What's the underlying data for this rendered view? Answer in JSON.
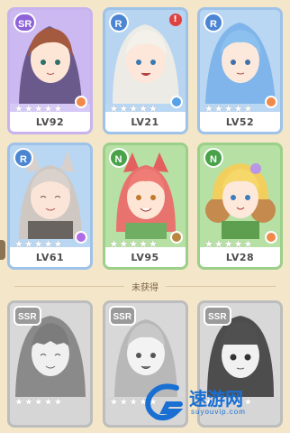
{
  "collected_label_unacquired": "未获得",
  "watermark": {
    "text": "速游网",
    "sub": "suyouvip.com"
  },
  "colors": {
    "rarity_sr": "#8e63d8",
    "rarity_r": "#4c86d3",
    "rarity_n": "#49a24a",
    "rarity_ssr": "#9a9a9a",
    "alert": "#e04040"
  },
  "cards": [
    {
      "rarity": "SR",
      "level": "LV92",
      "stars_lit": 0,
      "badge_color": "#f08a4b",
      "alert": false,
      "theme": "sr"
    },
    {
      "rarity": "R",
      "level": "LV21",
      "stars_lit": 0,
      "badge_color": "#58a0e8",
      "alert": true,
      "theme": "r"
    },
    {
      "rarity": "R",
      "level": "LV52",
      "stars_lit": 0,
      "badge_color": "#f08a4b",
      "alert": false,
      "theme": "r"
    },
    {
      "rarity": "R",
      "level": "LV61",
      "stars_lit": 0,
      "badge_color": "#b06be6",
      "alert": false,
      "theme": "r"
    },
    {
      "rarity": "N",
      "level": "LV95",
      "stars_lit": 0,
      "badge_color": "#b9873f",
      "alert": false,
      "theme": "n"
    },
    {
      "rarity": "N",
      "level": "LV28",
      "stars_lit": 0,
      "badge_color": "#f08a4b",
      "alert": false,
      "theme": "n"
    }
  ],
  "locked_cards": [
    {
      "rarity": "SSR",
      "badge_color": "#bdbdbd"
    },
    {
      "rarity": "SSR",
      "badge_color": "#bdbdbd"
    },
    {
      "rarity": "SSR",
      "badge_color": "#bdbdbd"
    }
  ],
  "alert_glyph": "!"
}
